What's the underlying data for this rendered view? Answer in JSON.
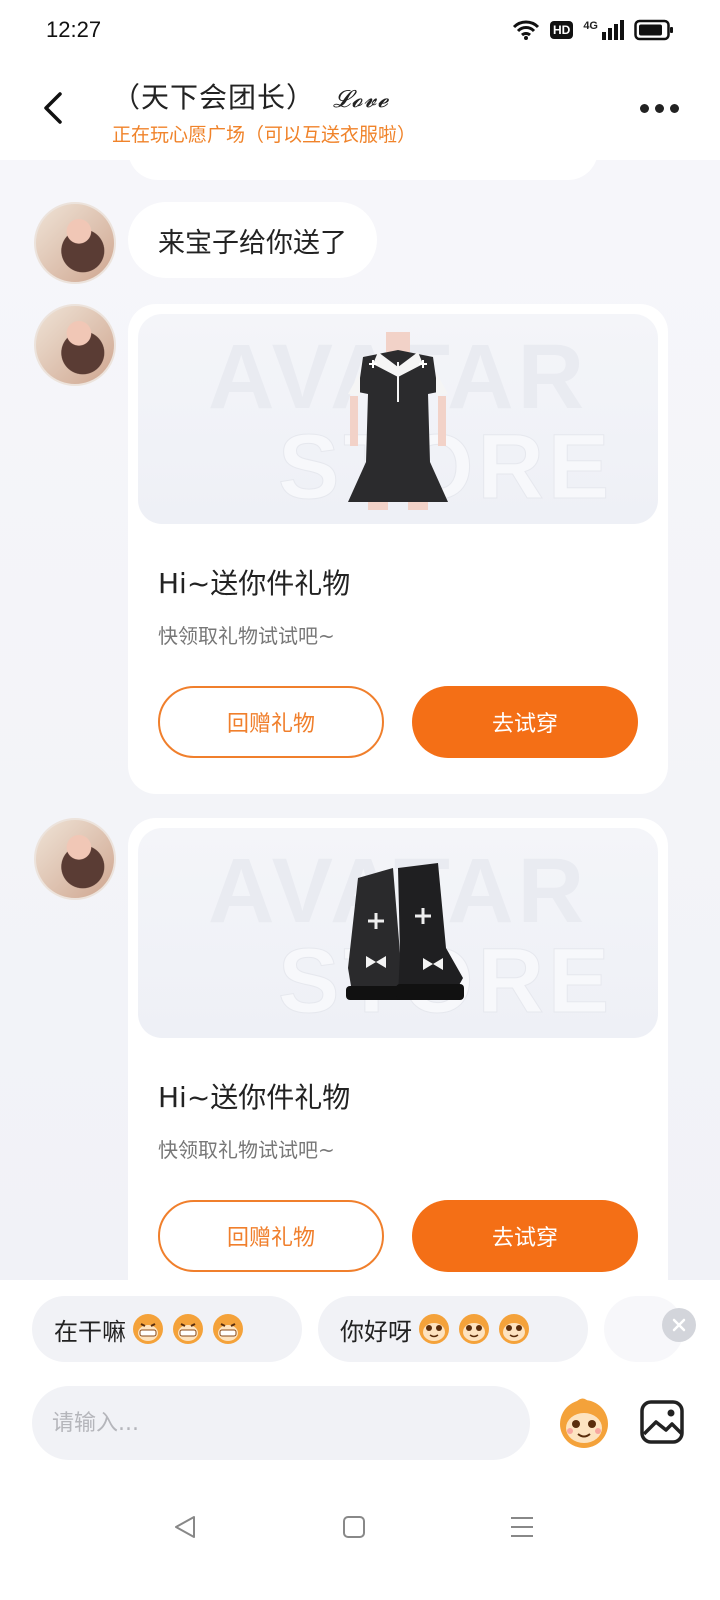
{
  "status_bar": {
    "time": "12:27",
    "hd_label": "HD",
    "network_label": "4G"
  },
  "header": {
    "title": "（天下会团长）",
    "title_love": "𝓛𝓸𝓿𝓮",
    "subtitle": "正在玩心愿广场（可以互送衣服啦）"
  },
  "messages": {
    "text_message": "来宝子给你送了",
    "gifts": [
      {
        "watermark_line1": "AVATAR",
        "watermark_line2": "STORE",
        "item_icon": "dress-icon",
        "title": "Hi~送你件礼物",
        "desc": "快领取礼物试试吧~",
        "return_label": "回赠礼物",
        "try_label": "去试穿"
      },
      {
        "watermark_line1": "AVATAR",
        "watermark_line2": "STORE",
        "item_icon": "boots-icon",
        "title": "Hi~送你件礼物",
        "desc": "快领取礼物试试吧~",
        "return_label": "回赠礼物",
        "try_label": "去试穿"
      }
    ]
  },
  "quick_replies": [
    {
      "label": "在干嘛",
      "emoji": "grin-monkey-icon"
    },
    {
      "label": "你好呀",
      "emoji": "smile-monkey-icon"
    }
  ],
  "input": {
    "placeholder": "请输入..."
  },
  "colors": {
    "accent": "#f46f16",
    "accent_text": "#f0832a",
    "background": "#f3f4f8"
  }
}
